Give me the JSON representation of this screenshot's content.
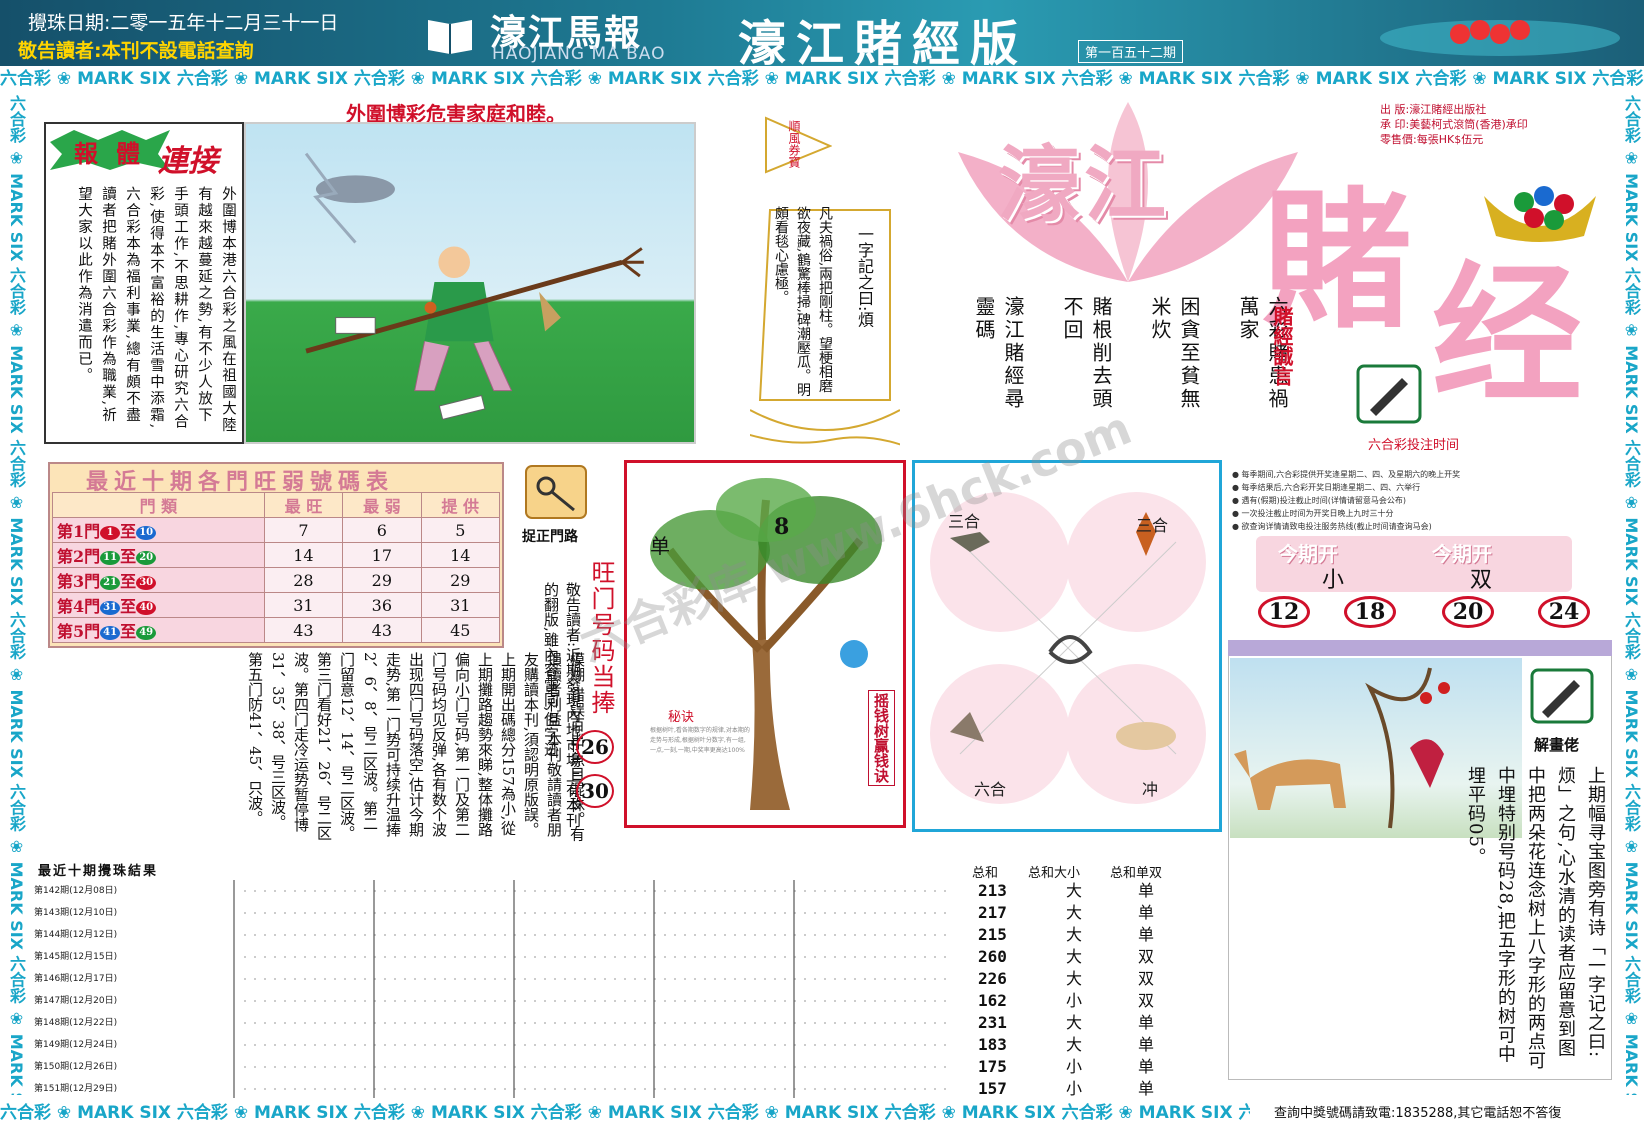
{
  "header": {
    "date": "攪珠日期:二零一五年十二月三十一日",
    "notice": "敬告讀者:本刊不設電話查詢",
    "masthead": "濠江馬報",
    "masthead_roman": "HAOJIANG MA BAO",
    "edition": "濠江賭經版",
    "issue": "第一百五十二期"
  },
  "marquee": {
    "text": "六合彩 ❀ MARK SIX 六合彩 ❀ MARK SIX 六合彩 ❀ MARK SIX 六合彩 ❀ MARK SIX 六合彩 ❀ MARK SIX 六合彩 ❀ MARK SIX 六合彩 ❀ MARK SIX 六合彩 ❀ MARK SIX 六合彩 ❀ MARK SIX 六合彩 ❀ MARK SIX"
  },
  "warning_title": "外圍博彩危害家庭和睦。",
  "report": {
    "badge": "報體",
    "link": "連接",
    "body": "外圍博本港六合彩之風在祖國大陸有越來越蔓延之勢,有不少人放下手頭工作,不思耕作,專心研究六合彩,使得本不富裕的生活雪中添霜,六合彩本為福利事業,總有頗不盡讀者把賭外圍六合彩作為職業,祈望大家以此作為消遣而已。"
  },
  "sail": {
    "flag": "順風券寶",
    "title": "一字記之曰:煩",
    "poem": "凡夫禍俗,兩把剛柱。望梗相磨欲夜藏,鶴驚棒掃,碑潮壓瓜。明頗看毯心慮極。"
  },
  "logo": {
    "haojiang": "濠江",
    "du": "賭",
    "jing": "经"
  },
  "publisher": {
    "line1": "出  版:濠江賭經出版社",
    "line2": "承  印:美藝柯式滾筒(香港)承印",
    "line3": "零售價:每張HK$伍元"
  },
  "motto": {
    "label": "賭經誠言",
    "col1": "六彩賭患禍萬家",
    "col2": "困貪至貧無米炊",
    "col3": "賭根削去頭不回",
    "col4": "濠江賭經尋靈碼"
  },
  "betting_time": {
    "label": "六合彩投注时间",
    "notes": [
      "● 每季期间,六合彩提供开奖逢星期二、四、及星期六的晚上开奖",
      "● 每季结果后,六合彩开奖日期逢星期二、四、六举行",
      "● 遇有(假期)投注截止时间(详情请留意马会公布)",
      "● 一次投注截止时间为开奖日晚上九时三十分",
      "● 欲查询详情请致电投注服务热线(截止时间请查询马会)"
    ]
  },
  "table": {
    "title": "最近十期各門旺弱號碼表",
    "headers": [
      "門 類",
      "最 旺",
      "最 弱",
      "提 供"
    ],
    "rows": [
      {
        "gate": "第1門",
        "from": "1",
        "to": "10",
        "hot": "7",
        "cold": "6",
        "offer": "5"
      },
      {
        "gate": "第2門",
        "from": "11",
        "to": "20",
        "hot": "14",
        "cold": "17",
        "offer": "14"
      },
      {
        "gate": "第3門",
        "from": "21",
        "to": "30",
        "hot": "28",
        "cold": "29",
        "offer": "29"
      },
      {
        "gate": "第4門",
        "from": "31",
        "to": "40",
        "hot": "31",
        "cold": "36",
        "offer": "31"
      },
      {
        "gate": "第5門",
        "from": "41",
        "to": "49",
        "hot": "43",
        "cold": "43",
        "offer": "45"
      }
    ],
    "to_word": "至"
  },
  "gate": {
    "label": "捉正門路",
    "col_a": "敬告讀者:近期發現內地市場上有本刊的翻版,雖內容雷同,但字迹",
    "col_b": "模糊,錯誤百出,魚目混珠。有損讀者利益,本刊敬請讀者朋友購讀本刊,須認明原版誤。上期開出碼總分157為小,從上期攤路趨勢來睇,整体攤路偏向小门号码,第一门及第二门号码均见反弹,各有数个波出现四门号码落空,估计今期走势,第一门势可持续升温捧2、6、8、号二区波。第二门留意12、14、号二区波。第三门看好21、26、号二区波。第四门走冷运势暂停博31、35、38、号三区波。第五门防41、45、只波。",
    "hot_title": "旺门号码当捧",
    "hot1": "26",
    "hot2": "30"
  },
  "tree": {
    "number": "8",
    "single": "单",
    "tag": "摇钱树赢钱诀",
    "note_title": "秘诀",
    "note": "根据树叶,看各期数字的规律,对本期的走势与形成,根据树叶分数字,有一组,一点,一刻,一期,中奖率更高达100%"
  },
  "zodiac": {
    "sanhe_left": "三合",
    "sanhe_right": "三合",
    "liuhe": "六合",
    "chong": "冲"
  },
  "this_period": {
    "head1": "今期开",
    "head2": "今期开",
    "value1": "小",
    "value2": "双",
    "numbers": [
      "12",
      "18",
      "20",
      "24"
    ]
  },
  "explain": {
    "label": "解畫佬",
    "text": "上期幅寻宝图旁有诗「一字记之曰:烦」之句,心水清的读者应留意到图中把两朵花连念树上八字形的两点可中埋特别号码28,把五字形的树可中埋平码05。"
  },
  "footer_inquiry": "查詢中獎號碼請致電:1835288,其它電話恕不答復",
  "results": {
    "title": "最近十期攪珠結果",
    "sum_header": "总和",
    "size_header": "总和大小",
    "odd_header": "总和单双",
    "rows": [
      {
        "label": "第142期(12月08日)",
        "sum": "213",
        "size": "大",
        "parity": "单"
      },
      {
        "label": "第143期(12月10日)",
        "sum": "217",
        "size": "大",
        "parity": "单"
      },
      {
        "label": "第144期(12月12日)",
        "sum": "215",
        "size": "大",
        "parity": "单"
      },
      {
        "label": "第145期(12月15日)",
        "sum": "260",
        "size": "大",
        "parity": "双"
      },
      {
        "label": "第146期(12月17日)",
        "sum": "226",
        "size": "大",
        "parity": "双"
      },
      {
        "label": "第147期(12月20日)",
        "sum": "162",
        "size": "小",
        "parity": "双"
      },
      {
        "label": "第148期(12月22日)",
        "sum": "231",
        "size": "大",
        "parity": "单"
      },
      {
        "label": "第149期(12月24日)",
        "sum": "183",
        "size": "大",
        "parity": "单"
      },
      {
        "label": "第150期(12月26日)",
        "sum": "175",
        "size": "小",
        "parity": "单"
      },
      {
        "label": "第151期(12月29日)",
        "sum": "157",
        "size": "小",
        "parity": "单"
      }
    ]
  },
  "watermark": "六合彩库 www.6hck.com",
  "colors": {
    "header_bg": "#1e7a93",
    "accent_red": "#d0102a",
    "marquee": "#19a6c8",
    "pink": "#f3a2c0",
    "zodiac_border": "#20a6d8"
  }
}
